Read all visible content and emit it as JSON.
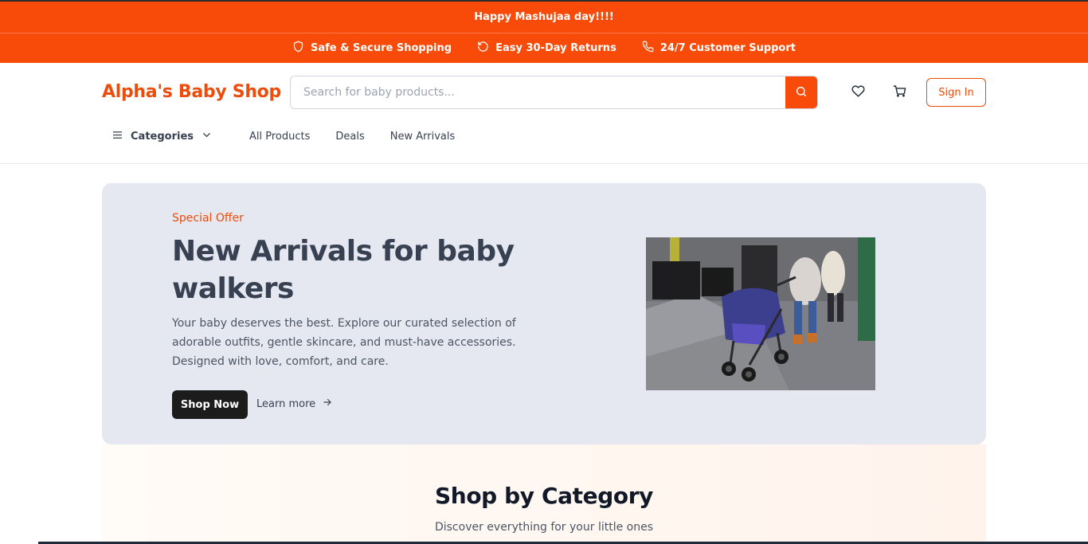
{
  "promo": {
    "text": "Happy Mashujaa day!!!!"
  },
  "features": [
    {
      "label": "Safe & Secure Shopping",
      "icon": "shield-icon"
    },
    {
      "label": "Easy 30-Day Returns",
      "icon": "refresh-icon"
    },
    {
      "label": "24/7 Customer Support",
      "icon": "phone-icon"
    }
  ],
  "header": {
    "logo": "Alpha's Baby Shop",
    "search_placeholder": "Search for baby products...",
    "sign_in": "Sign In"
  },
  "nav": {
    "categories": "Categories",
    "links": [
      "All Products",
      "Deals",
      "New Arrivals"
    ]
  },
  "hero": {
    "eyebrow": "Special Offer",
    "title": "New Arrivals for baby walkers",
    "description": "Your baby deserves the best. Explore our curated selection of adorable outfits, gentle skincare, and must-have accessories. Designed with love, comfort, and care.",
    "primary_button": "Shop Now",
    "secondary_link": "Learn more"
  },
  "category_section": {
    "title": "Shop by Category",
    "subtitle": "Discover everything for your little ones"
  },
  "colors": {
    "accent": "#f84b0a",
    "brand_text": "#ea4d0c",
    "hero_bg": "#e6e8f1"
  }
}
